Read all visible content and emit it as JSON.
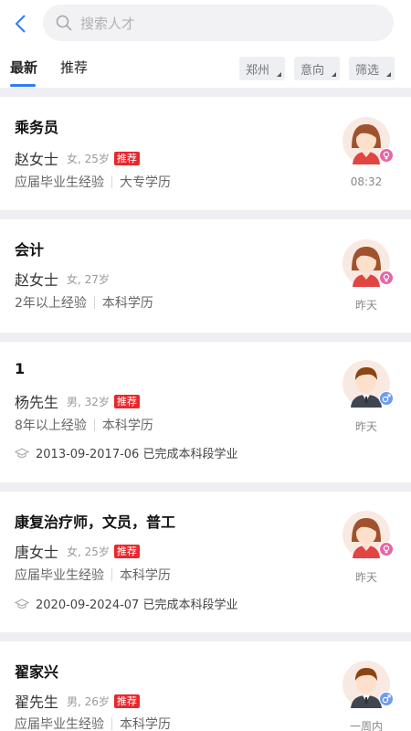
{
  "search": {
    "placeholder": "搜索人才"
  },
  "tabs": [
    {
      "label": "最新"
    },
    {
      "label": "推荐"
    }
  ],
  "filters": [
    {
      "label": "郑州"
    },
    {
      "label": "意向"
    },
    {
      "label": "筛选"
    }
  ],
  "cards": [
    {
      "job": "乘务员",
      "name": "赵女士",
      "meta": "女, 25岁",
      "tag": "推荐",
      "experience": "应届毕业生经验",
      "education": "大专学历",
      "time": "08:32",
      "gender": "female"
    },
    {
      "job": "会计",
      "name": "赵女士",
      "meta": "女, 27岁",
      "experience": "2年以上经验",
      "education": "本科学历",
      "time": "昨天",
      "gender": "female"
    },
    {
      "job": "1",
      "name": "杨先生",
      "meta": "男, 32岁",
      "tag": "推荐",
      "experience": "8年以上经验",
      "education": "本科学历",
      "edu_history": "2013-09-2017-06 已完成本科段学业",
      "time": "昨天",
      "gender": "male"
    },
    {
      "job": "康复治疗师，文员，普工",
      "name": "唐女士",
      "meta": "女, 25岁",
      "tag": "推荐",
      "experience": "应届毕业生经验",
      "education": "本科学历",
      "edu_history": "2020-09-2024-07 已完成本科段学业",
      "time": "昨天",
      "gender": "female"
    },
    {
      "job": "翟家兴",
      "name": "翟先生",
      "meta": "男, 26岁",
      "tag": "推荐",
      "experience": "应届毕业生经验",
      "education": "本科学历",
      "time": "一周内",
      "gender": "male"
    }
  ],
  "colors": {
    "accent": "#2f7cf6",
    "tag": "#e8272c",
    "female_badge": "#e766a6",
    "male_badge": "#6f9ce9"
  },
  "icons": [
    "back-arrow-icon",
    "search-icon",
    "graduation-cap-icon",
    "female-icon",
    "male-icon"
  ]
}
